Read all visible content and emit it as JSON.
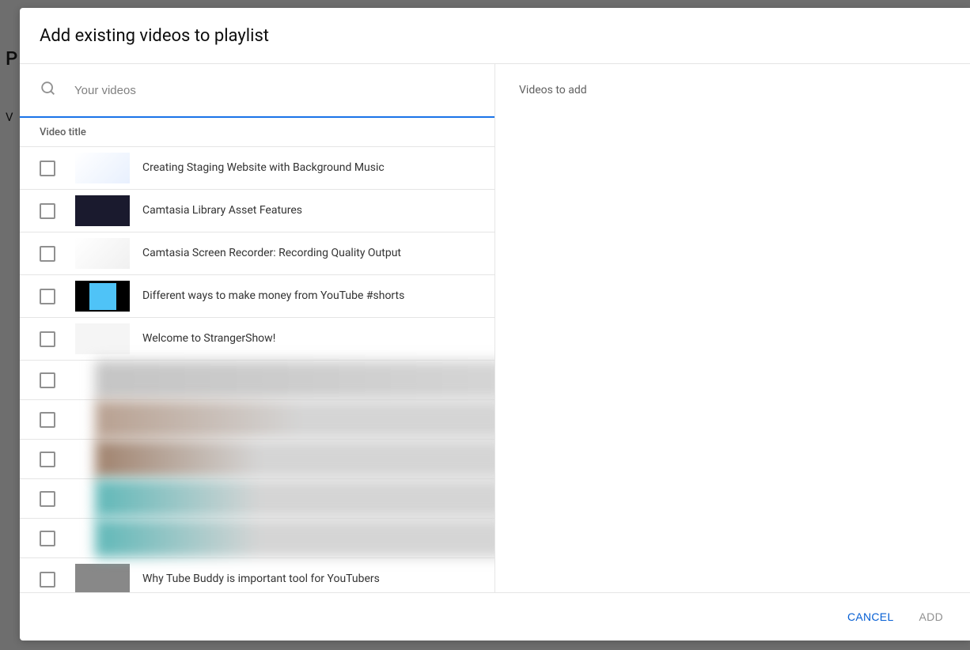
{
  "modal": {
    "title": "Add existing videos to playlist"
  },
  "search": {
    "placeholder": "Your videos"
  },
  "listHeader": "Video title",
  "videos": [
    {
      "title": "Creating Staging Website with Background Music"
    },
    {
      "title": "Camtasia Library Asset Features"
    },
    {
      "title": "Camtasia Screen Recorder: Recording Quality Output"
    },
    {
      "title": "Different ways to make money from YouTube #shorts"
    },
    {
      "title": "Welcome to StrangerShow!"
    },
    {
      "title": ""
    },
    {
      "title": ""
    },
    {
      "title": ""
    },
    {
      "title": ""
    },
    {
      "title": ""
    },
    {
      "title": "Why Tube Buddy is important tool for YouTubers"
    }
  ],
  "rightPanel": {
    "header": "Videos to add"
  },
  "buttons": {
    "cancel": "CANCEL",
    "add": "ADD"
  },
  "background": {
    "text1": "P",
    "text2": "V"
  }
}
